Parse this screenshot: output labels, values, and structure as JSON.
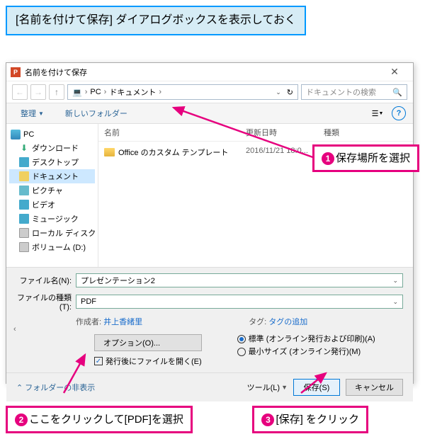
{
  "caption_top": "[名前を付けて保存] ダイアログボックスを表示しておく",
  "dialog": {
    "title": "名前を付けて保存",
    "breadcrumb": {
      "root": "PC",
      "folder": "ドキュメント"
    },
    "search_placeholder": "ドキュメントの検索",
    "toolbar": {
      "organize": "整理",
      "new_folder": "新しいフォルダー"
    },
    "columns": {
      "name": "名前",
      "date": "更新日時",
      "type": "種類"
    },
    "tree": {
      "pc": "PC",
      "downloads": "ダウンロード",
      "desktop": "デスクトップ",
      "documents": "ドキュメント",
      "pictures": "ピクチャ",
      "videos": "ビデオ",
      "music": "ミュージック",
      "localdisk": "ローカル ディスク (C",
      "volume": "ボリューム (D:)"
    },
    "file_row": {
      "name": "Office のカスタム テンプレート",
      "date": "2016/11/21 18:0..."
    },
    "form": {
      "filename_label": "ファイル名(N):",
      "filename_value": "プレゼンテーション2",
      "filetype_label": "ファイルの種類(T):",
      "filetype_value": "PDF",
      "author_label": "作成者:",
      "author_value": "井上香緒里",
      "tags_label": "タグ:",
      "tags_value": "タグの追加",
      "options_btn": "オプション(O)...",
      "open_after": "発行後にファイルを開く(E)",
      "radio_standard": "標準 (オンライン発行および印刷)(A)",
      "radio_min": "最小サイズ (オンライン発行)(M)"
    },
    "footer": {
      "hide_folders": "フォルダーの非表示",
      "tools": "ツール(L)",
      "save": "保存(S)",
      "cancel": "キャンセル"
    }
  },
  "callouts": {
    "c1": "保存場所を選択",
    "c2": "ここをクリックして[PDF]を選択",
    "c3": "[保存] をクリック"
  }
}
